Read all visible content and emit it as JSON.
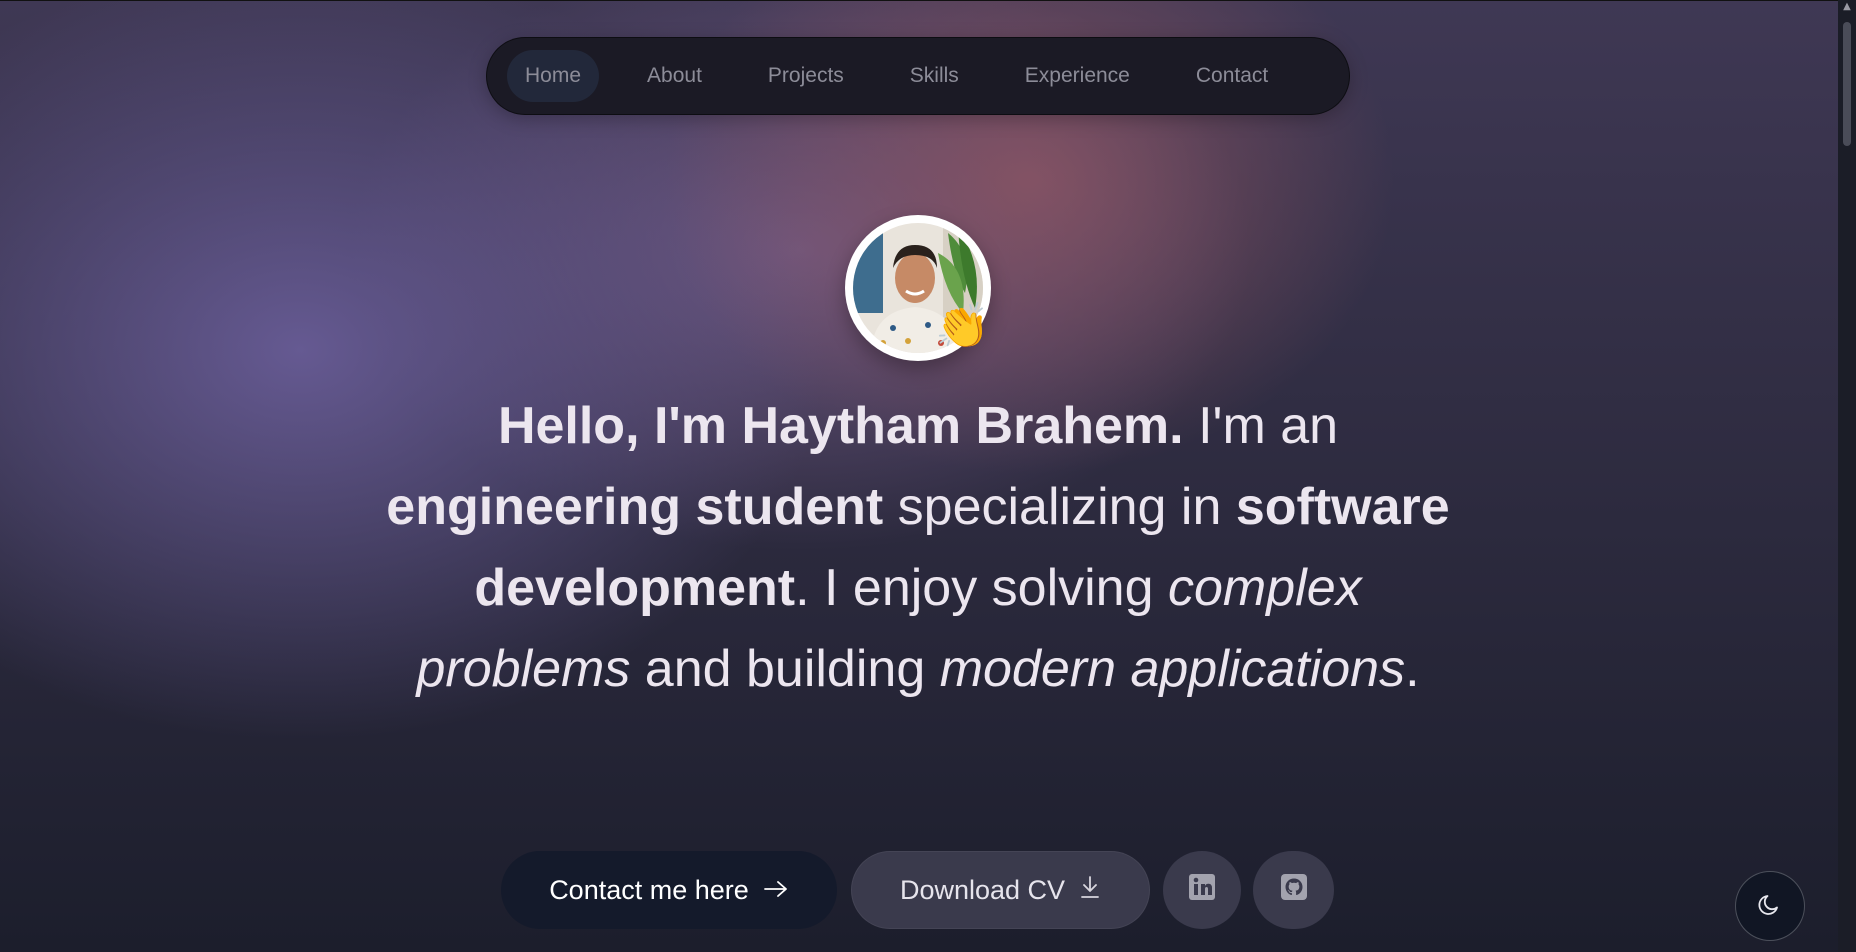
{
  "nav": {
    "items": [
      {
        "label": "Home",
        "active": true
      },
      {
        "label": "About",
        "active": false
      },
      {
        "label": "Projects",
        "active": false
      },
      {
        "label": "Skills",
        "active": false
      },
      {
        "label": "Experience",
        "active": false
      },
      {
        "label": "Contact",
        "active": false
      }
    ]
  },
  "hero": {
    "avatar_icon": "profile-photo",
    "wave_emoji": "👏",
    "headline": {
      "p1_bold": "Hello, I'm Haytham Brahem.",
      "p2": " I'm an ",
      "p3_bold": "engineering student",
      "p4": " specializing in ",
      "p5_bold": "software development",
      "p6": ". I enjoy solving ",
      "p7_italic": "complex problems",
      "p8": " and building ",
      "p9_italic": "modern applications",
      "p10": "."
    }
  },
  "actions": {
    "contact_label": "Contact me here",
    "contact_icon": "arrow-right-icon",
    "cv_label": "Download CV",
    "cv_icon": "download-icon",
    "linkedin_icon": "linkedin-icon",
    "github_icon": "github-icon"
  },
  "theme_toggle": {
    "icon": "moon-icon"
  },
  "colors": {
    "accent_dark": "#141a2b",
    "text_light": "#ece6ef",
    "nav_bg": "#1b1a25"
  }
}
